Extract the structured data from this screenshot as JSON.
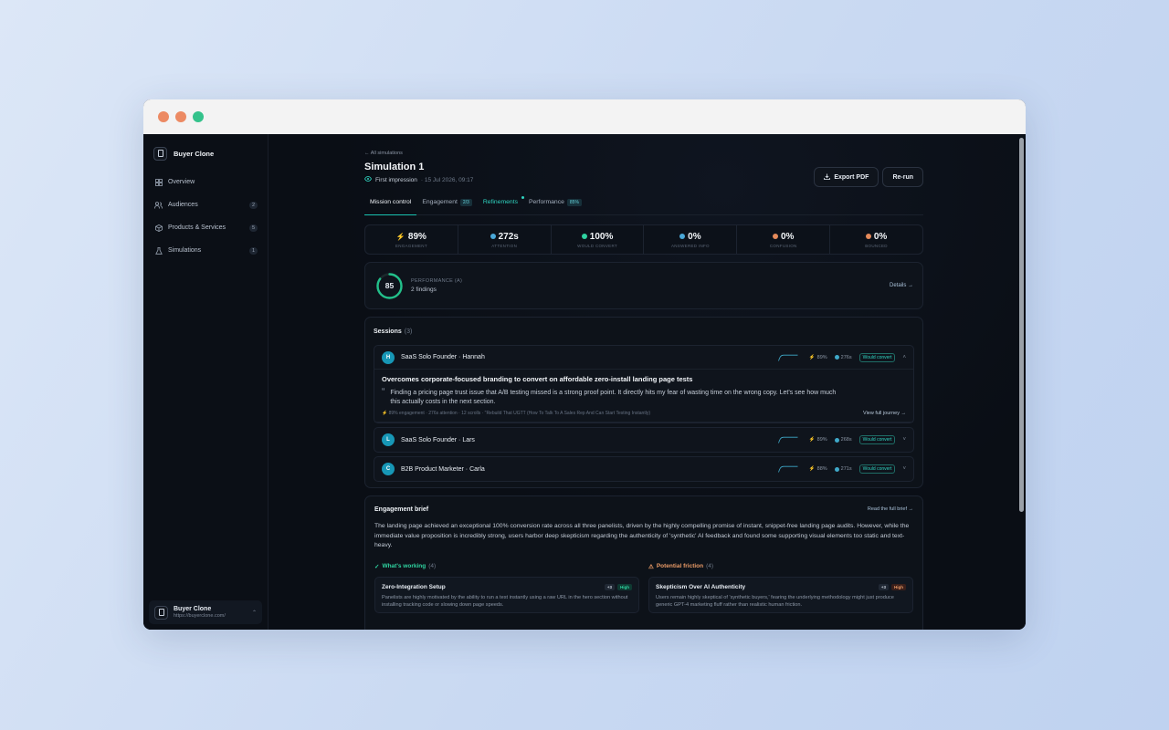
{
  "window": {
    "dots": [
      "#ec8a63",
      "#ec8a63",
      "#34c28b"
    ]
  },
  "sidebar": {
    "brand": "Buyer Clone",
    "items": [
      {
        "label": "Overview",
        "count": ""
      },
      {
        "label": "Audiences",
        "count": "2"
      },
      {
        "label": "Products & Services",
        "count": "5"
      },
      {
        "label": "Simulations",
        "count": "1"
      }
    ],
    "footer": {
      "name": "Buyer Clone",
      "url": "https://buyerclone.com/"
    }
  },
  "header": {
    "back": "← All simulations",
    "title": "Simulation 1",
    "mode": "First impression",
    "date": "· 15 Jul 2026, 09:17",
    "export_label": "Export PDF",
    "rerun_label": "Re-run"
  },
  "tabs": [
    {
      "label": "Mission control",
      "tag": ""
    },
    {
      "label": "Engagement",
      "tag": "2/3"
    },
    {
      "label": "Refinements",
      "tag": ""
    },
    {
      "label": "Performance",
      "tag": "85%"
    }
  ],
  "stats": [
    {
      "value": "89%",
      "label": "ENGAGEMENT",
      "color": "#4aa8d8"
    },
    {
      "value": "272s",
      "label": "ATTENTION",
      "color": "#4aa8d8"
    },
    {
      "value": "100%",
      "label": "WOULD CONVERT",
      "color": "#2fd3a0"
    },
    {
      "value": "0%",
      "label": "ANSWERED INFO",
      "color": "#4aa8d8"
    },
    {
      "value": "0%",
      "label": "CONFUSION",
      "color": "#e58a5a"
    },
    {
      "value": "0%",
      "label": "BOUNCED",
      "color": "#e58a5a"
    }
  ],
  "performance": {
    "score": "85",
    "score_fraction": 0.85,
    "label": "PERFORMANCE (A)",
    "findings": "2 findings",
    "details": "Details →"
  },
  "sessions": {
    "title": "Sessions",
    "count": "(3)",
    "rows": [
      {
        "initial": "H",
        "name": "SaaS Solo Founder · Hannah",
        "engagement": "89%",
        "time": "276s",
        "status": "Would convert"
      },
      {
        "initial": "L",
        "name": "SaaS Solo Founder · Lars",
        "engagement": "89%",
        "time": "268s",
        "status": "Would convert"
      },
      {
        "initial": "C",
        "name": "B2B Product Marketer · Carla",
        "engagement": "88%",
        "time": "271s",
        "status": "Would convert"
      }
    ],
    "expanded": {
      "headline": "Overcomes corporate-focused branding to convert on affordable zero-install landing page tests",
      "quote": "Finding a pricing page trust issue that A/B testing missed is a strong proof point. It directly hits my fear of wasting time on the wrong copy. Let's see how much this actually costs in the next section.",
      "meta": "⚡ 89% engagement · 276s attention · 12 scrolls · \"Rebuild That UGTT (How To Talk To A Sales Rep And Can Start Testing Instantly)",
      "view": "View full journey →"
    }
  },
  "brief": {
    "title": "Engagement brief",
    "read": "Read the full brief →",
    "text": "The landing page achieved an exceptional 100% conversion rate across all three panelists, driven by the highly compelling promise of instant, snippet-free landing page audits. However, while the immediate value proposition is incredibly strong, users harbor deep skepticism regarding the authenticity of 'synthetic' AI feedback and found some supporting visual elements too static and text-heavy.",
    "working": {
      "title": "What's working",
      "count": "(4)",
      "card": {
        "title": "Zero-Integration Setup",
        "plus": "+3",
        "level": "High",
        "desc": "Panelists are highly motivated by the ability to run a test instantly using a raw URL in the hero section without installing tracking code or slowing down page speeds."
      }
    },
    "friction": {
      "title": "Potential friction",
      "count": "(4)",
      "card": {
        "title": "Skepticism Over AI Authenticity",
        "plus": "+3",
        "level": "High",
        "desc": "Users remain highly skeptical of 'synthetic buyers,' fearing the underlying methodology might just produce generic GPT-4 marketing fluff rather than realistic human friction."
      }
    }
  }
}
